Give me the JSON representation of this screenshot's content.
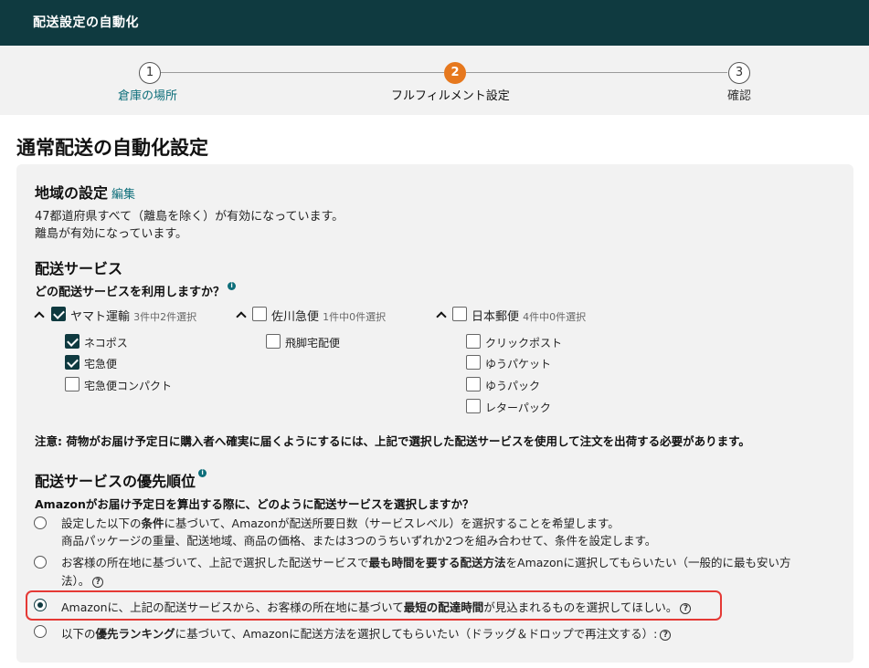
{
  "header": {
    "title": "配送設定の自動化"
  },
  "stepper": {
    "steps": [
      {
        "number": "1",
        "label": "倉庫の場所"
      },
      {
        "number": "2",
        "label": "フルフィルメント設定"
      },
      {
        "number": "3",
        "label": "確認"
      }
    ]
  },
  "page": {
    "title": "通常配送の自動化設定"
  },
  "region": {
    "heading": "地域の設定",
    "edit": "編集",
    "line1": "47都道府県すべて（離島を除く）が有効になっています。",
    "line2": "離島が有効になっています。"
  },
  "services": {
    "heading": "配送サービス",
    "question": "どの配送サービスを利用しますか？",
    "info": "i",
    "carriers": [
      {
        "name": "ヤマト運輸",
        "count": "3件中2件選択",
        "checked": true,
        "options": [
          {
            "label": "ネコポス",
            "checked": true
          },
          {
            "label": "宅急便",
            "checked": true
          },
          {
            "label": "宅急便コンパクト",
            "checked": false
          }
        ]
      },
      {
        "name": "佐川急便",
        "count": "1件中0件選択",
        "checked": false,
        "options": [
          {
            "label": "飛脚宅配便",
            "checked": false
          }
        ]
      },
      {
        "name": "日本郵便",
        "count": "4件中0件選択",
        "checked": false,
        "options": [
          {
            "label": "クリックポスト",
            "checked": false
          },
          {
            "label": "ゆうパケット",
            "checked": false
          },
          {
            "label": "ゆうパック",
            "checked": false
          },
          {
            "label": "レターパック",
            "checked": false
          }
        ]
      }
    ],
    "note": "注意: 荷物がお届け予定日に購入者へ確実に届くようにするには、上記で選択した配送サービスを使用して注文を出荷する必要があります。"
  },
  "priority": {
    "heading": "配送サービスの優先順位",
    "info": "i",
    "question": "Amazonがお届け予定日を算出する際に、どのように配送サービスを選択しますか？",
    "help": "?",
    "options": [
      {
        "pre": "設定した以下の",
        "bold": "条件",
        "post": "に基づいて、Amazonが配送所要日数（サービスレベル）を選択することを希望します。",
        "line2": "商品パッケージの重量、配送地域、商品の価格、または3つのうちいずれか2つを組み合わせて、条件を設定します。",
        "selected": false
      },
      {
        "pre": "お客様の所在地に基づいて、上記で選択した配送サービスで",
        "bold": "最も時間を要する配送方法",
        "post": "をAmazonに選択してもらいたい（一般的に最も安い方",
        "line2": "法）。",
        "selected": false
      },
      {
        "pre": "Amazonに、上記の配送サービスから、お客様の所在地に基づいて",
        "bold": "最短の配達時間",
        "post": "が見込まれるものを選択してほしい。",
        "selected": true
      },
      {
        "pre": "以下の",
        "bold": "優先ランキング",
        "post": "に基づいて、Amazonに配送方法を選択してもらいたい（ドラッグ＆ドロップで再注文する）:",
        "selected": false
      }
    ]
  }
}
